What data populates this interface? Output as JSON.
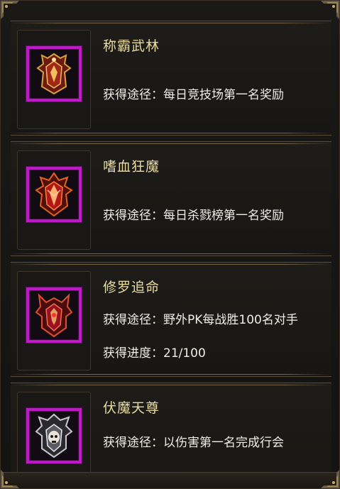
{
  "titles": [
    {
      "name": "称霸武林",
      "acquire_label": "获得途径：",
      "acquire_text": "每日竞技场第一名奖励",
      "icon": "gold-shield-emblem-icon"
    },
    {
      "name": "嗜血狂魔",
      "acquire_label": "获得途径：",
      "acquire_text": "每日杀戮榜第一名奖励",
      "icon": "red-spiked-shield-icon"
    },
    {
      "name": "修罗追命",
      "acquire_label": "获得途径：",
      "acquire_text": "野外PK每战胜100名对手",
      "progress_label": "获得进度：",
      "progress_text": "21/100",
      "progress": {
        "current": 21,
        "total": 100
      },
      "icon": "crimson-horned-shield-icon"
    },
    {
      "name": "伏魔天尊",
      "acquire_label": "获得途径：",
      "acquire_text": "以伤害第一名完成行会",
      "icon": "silver-skull-shield-icon"
    }
  ],
  "colors": {
    "title": "#e8dca0",
    "body_text": "#f0ece6",
    "frame_purple": "#c018c8",
    "card_border": "#5a4c36"
  }
}
